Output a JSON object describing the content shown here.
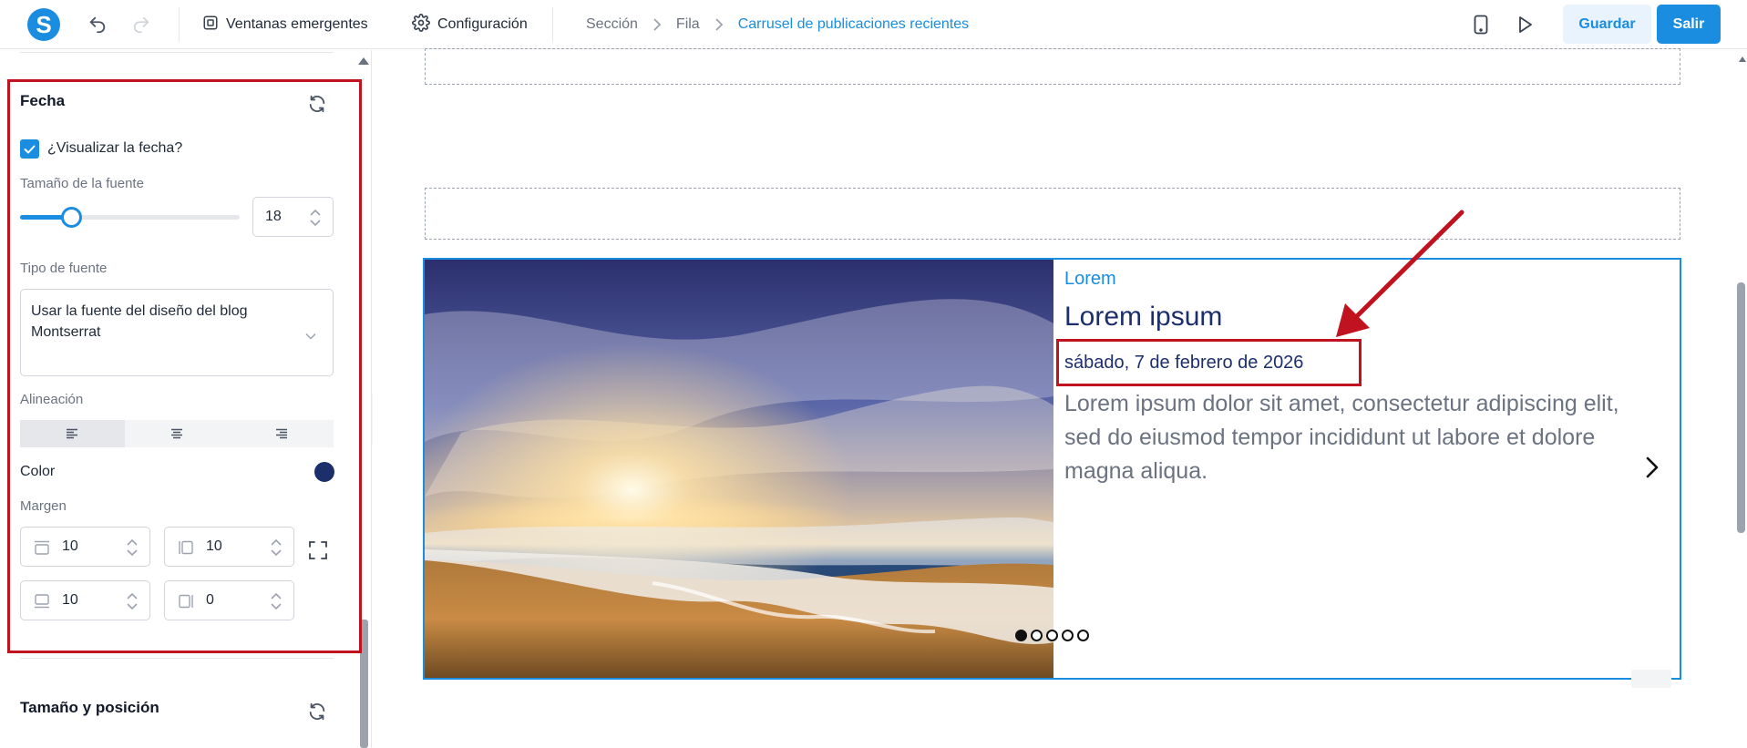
{
  "app": {
    "logo_letter": "S"
  },
  "toolbar": {
    "popups_label": "Ventanas emergentes",
    "settings_label": "Configuración",
    "save_label": "Guardar",
    "exit_label": "Salir"
  },
  "breadcrumb": [
    "Sección",
    "Fila",
    "Carrusel de publicaciones recientes"
  ],
  "panel": {
    "date_section": {
      "title": "Fecha",
      "show_date_label": "¿Visualizar la fecha?",
      "show_date_checked": true,
      "font_size_label": "Tamaño de la fuente",
      "font_size_value": "18",
      "font_type_label": "Tipo de fuente",
      "font_type_value_line1": "Usar la fuente del diseño del blog",
      "font_type_value_line2": "Montserrat",
      "alignment_label": "Alineación",
      "alignment_selected": "left",
      "color_label": "Color",
      "color_value": "#1c2f6b",
      "margin_label": "Margen",
      "margin_top": "10",
      "margin_right": "10",
      "margin_bottom": "10",
      "margin_left": "0"
    },
    "size_section": {
      "title": "Tamaño y posición"
    }
  },
  "carousel": {
    "post": {
      "category": "Lorem",
      "title": "Lorem ipsum",
      "date": "sábado, 7 de febrero de 2026",
      "excerpt": "Lorem ipsum dolor sit amet, consectetur adipiscing elit, sed do eiusmod tempor incididunt ut labore et dolore magna aliqua."
    },
    "slide_count": 5,
    "active_slide": 1
  },
  "colors": {
    "accent": "#1a8de0",
    "highlight": "#c1121f",
    "date_text": "#1c2f6b"
  }
}
